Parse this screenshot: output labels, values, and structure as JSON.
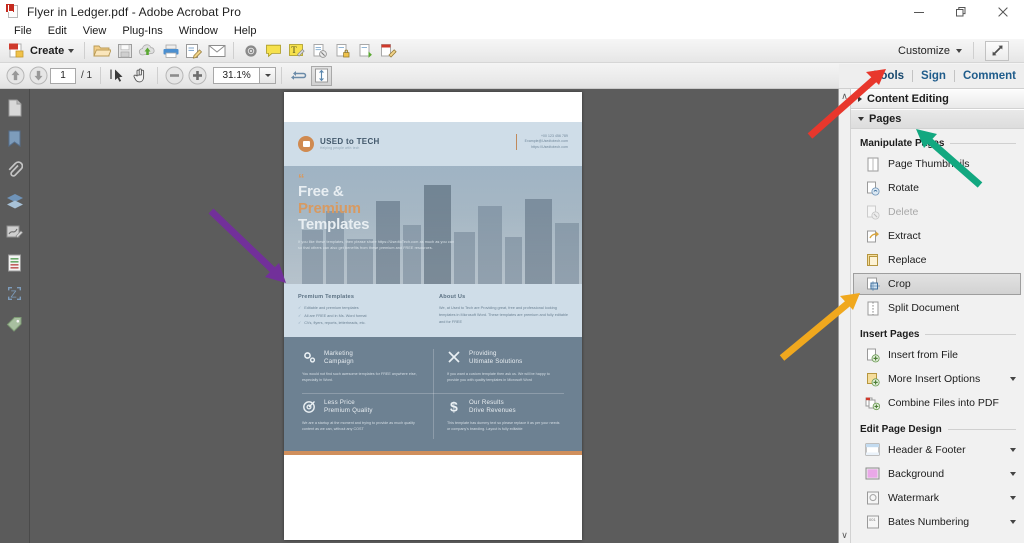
{
  "window": {
    "title": "Flyer in Ledger.pdf - Adobe Acrobat Pro",
    "app_icon": "acrobat-pdf-icon",
    "minimize": "minimize-icon",
    "restore": "restore-icon",
    "close": "close-icon"
  },
  "menubar": {
    "items": [
      {
        "label": "File"
      },
      {
        "label": "Edit"
      },
      {
        "label": "View"
      },
      {
        "label": "Plug-Ins"
      },
      {
        "label": "Window"
      },
      {
        "label": "Help"
      }
    ]
  },
  "toolbar": {
    "create_label": "Create",
    "customize_label": "Customize",
    "buttons": [
      {
        "name": "open-file-button",
        "icon": "open-folder-icon"
      },
      {
        "name": "save-button",
        "icon": "floppy-disk-icon"
      },
      {
        "name": "upload-cloud-button",
        "icon": "cloud-upload-icon"
      },
      {
        "name": "print-button",
        "icon": "printer-icon"
      },
      {
        "name": "sign-form-button",
        "icon": "form-pencil-icon"
      },
      {
        "name": "email-button",
        "icon": "envelope-icon"
      },
      {
        "name": "settings-button",
        "icon": "gear-icon"
      },
      {
        "name": "sticky-note-button",
        "icon": "comment-bubble-icon"
      },
      {
        "name": "highlight-text-button",
        "icon": "highlighter-icon"
      },
      {
        "name": "remove-page-button",
        "icon": "page-delete-icon"
      },
      {
        "name": "secure-page-button",
        "icon": "page-lock-icon"
      },
      {
        "name": "export-page-button",
        "icon": "page-export-icon"
      },
      {
        "name": "edit-page-button",
        "icon": "page-edit-icon"
      }
    ],
    "expand_button": "expand-arrows-icon"
  },
  "navbar": {
    "previous_page": "arrow-up-icon",
    "next_page": "arrow-down-icon",
    "page_value": "1",
    "page_total": "/ 1",
    "select_tool": "cursor-select-icon",
    "hand_tool": "hand-pan-icon",
    "zoom_out": "minus-circle-icon",
    "zoom_in": "plus-circle-icon",
    "zoom_value": "31.1%",
    "zoom_dropdown": "chevron-down-icon",
    "rotate_view": "rotate-view-icon",
    "fit_page": "fit-page-icon"
  },
  "tabs": [
    {
      "label": "Tools",
      "active": true
    },
    {
      "label": "Sign",
      "active": false
    },
    {
      "label": "Comment",
      "active": false
    }
  ],
  "leftnav": {
    "items": [
      {
        "name": "page-thumbnails-icon"
      },
      {
        "name": "bookmarks-icon"
      },
      {
        "name": "attachments-paperclip-icon"
      },
      {
        "name": "layers-icon"
      },
      {
        "name": "signatures-icon"
      },
      {
        "name": "content-icon"
      },
      {
        "name": "model-tree-icon"
      },
      {
        "name": "tags-icon"
      }
    ]
  },
  "panel": {
    "scroll_up": "chevron-up-icon",
    "scroll_down": "chevron-down-icon",
    "accordions": [
      {
        "label": "Content Editing",
        "expanded": false
      },
      {
        "label": "Pages",
        "expanded": true
      }
    ],
    "groups": [
      {
        "label": "Manipulate Pages",
        "items": [
          {
            "label": "Page Thumbnails",
            "icon": "page-thumbnails-icon",
            "disabled": false,
            "selected": false,
            "dropdown": false
          },
          {
            "label": "Rotate",
            "icon": "rotate-page-icon",
            "disabled": false,
            "selected": false,
            "dropdown": false
          },
          {
            "label": "Delete",
            "icon": "delete-page-icon",
            "disabled": true,
            "selected": false,
            "dropdown": false
          },
          {
            "label": "Extract",
            "icon": "extract-page-icon",
            "disabled": false,
            "selected": false,
            "dropdown": false
          },
          {
            "label": "Replace",
            "icon": "replace-page-icon",
            "disabled": false,
            "selected": false,
            "dropdown": false
          },
          {
            "label": "Crop",
            "icon": "crop-page-icon",
            "disabled": false,
            "selected": true,
            "dropdown": false
          },
          {
            "label": "Split Document",
            "icon": "split-document-icon",
            "disabled": false,
            "selected": false,
            "dropdown": false
          }
        ]
      },
      {
        "label": "Insert Pages",
        "items": [
          {
            "label": "Insert from File",
            "icon": "insert-from-file-icon",
            "disabled": false,
            "selected": false,
            "dropdown": false
          },
          {
            "label": "More Insert Options",
            "icon": "more-insert-options-icon",
            "disabled": false,
            "selected": false,
            "dropdown": true
          },
          {
            "label": "Combine Files into PDF",
            "icon": "combine-files-icon",
            "disabled": false,
            "selected": false,
            "dropdown": false
          }
        ]
      },
      {
        "label": "Edit Page Design",
        "items": [
          {
            "label": "Header & Footer",
            "icon": "header-footer-icon",
            "disabled": false,
            "selected": false,
            "dropdown": true
          },
          {
            "label": "Background",
            "icon": "background-icon",
            "disabled": false,
            "selected": false,
            "dropdown": true
          },
          {
            "label": "Watermark",
            "icon": "watermark-icon",
            "disabled": false,
            "selected": false,
            "dropdown": true
          },
          {
            "label": "Bates Numbering",
            "icon": "bates-numbering-icon",
            "disabled": false,
            "selected": false,
            "dropdown": true
          }
        ]
      }
    ]
  },
  "document": {
    "logo_name": "USED to TECH",
    "logo_tagline": "Helping people with tech",
    "contact": [
      "+00 123 456 789",
      "Example@Usedtotech.com",
      "https://Usedtotech.com"
    ],
    "hero": {
      "quote_mark": "“",
      "line1": "Free &",
      "line2": "Premium",
      "line3": "Templates",
      "paragraph": "If you like these templates, then please share https://UsedtoTech.com as much as you can so that others can also get benefits from these premium and FREE resources."
    },
    "left_column": {
      "heading": "Premium Templates",
      "bullets": [
        "Editable and premium templates",
        "All are FREE and in Ms. Word format",
        "CVs, flyers, reports, letterheads, etc."
      ]
    },
    "right_column": {
      "heading": "About Us",
      "paragraph": "We, at Used to Tech are Providing great, free and professional looking templates in Microsoft Word. These templates are premium and fully editable and for FREE"
    },
    "features": [
      {
        "icon": "gears-icon",
        "title_line1": "Marketing",
        "title_line2": "Campaign",
        "text": "You would not find such awesome templates for FREE anywhere else, especially in Word."
      },
      {
        "icon": "tools-cross-icon",
        "title_line1": "Providing",
        "title_line2": "Ultimate Solutions",
        "text": "If you want a custom template then ask us. We will be happy to provide you with quality templates in Microsoft Word"
      },
      {
        "icon": "target-arrow-icon",
        "title_line1": "Less Price",
        "title_line2": "Premium Quality",
        "text": "We are a startup at the moment and trying to provide as much quality content as we can, without any COST"
      },
      {
        "icon": "dollar-sign-icon",
        "title_line1": "Our Results",
        "title_line2": "Drive Revenues",
        "text": "This template has dummy text so please replace it as per your needs or company's branding. Layout is fully editable"
      }
    ]
  },
  "annotations": [
    {
      "name": "red-arrow-to-tools",
      "color": "#e8372c",
      "points_to": "Tools"
    },
    {
      "name": "green-arrow-to-pages",
      "color": "#12a880",
      "points_to": "Pages"
    },
    {
      "name": "orange-arrow-to-crop",
      "color": "#f0a81e",
      "points_to": "Crop"
    },
    {
      "name": "purple-arrow-to-document",
      "color": "#72309a",
      "points_to": "document page"
    }
  ],
  "colors": {
    "flyer_light_blue": "#cfdde8",
    "flyer_slate": "#6d8192",
    "flyer_orange": "#d08f5c",
    "tab_blue": "#1f5c8b",
    "doc_background": "#5c5c5c"
  }
}
